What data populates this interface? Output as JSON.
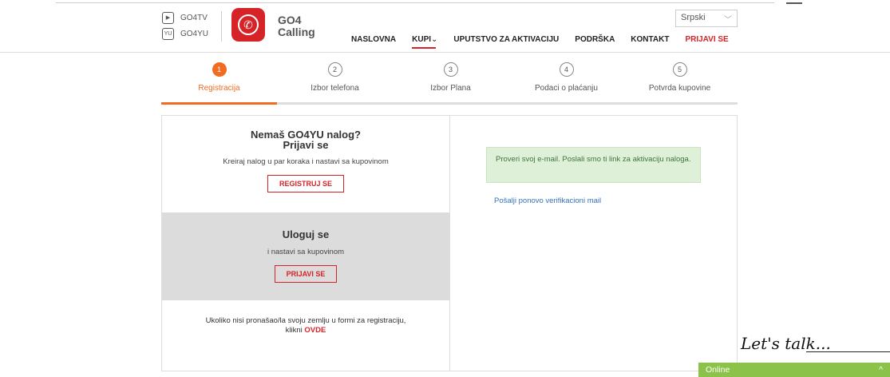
{
  "brands": [
    {
      "icon": "play-icon",
      "label": "GO4TV"
    },
    {
      "icon": "yu-icon",
      "label": "GO4YU"
    }
  ],
  "logo": {
    "line1": "GO4",
    "line2": "Calling"
  },
  "nav": {
    "items": [
      "NASLOVNA",
      "KUPI",
      "UPUTSTVO ZA AKTIVACIJU",
      "PODRŠKA",
      "KONTAKT"
    ],
    "kupi_caret": "⌄",
    "login": "PRIJAVI SE"
  },
  "language": {
    "selected": "Srpski"
  },
  "steps": [
    {
      "num": "1",
      "label": "Registracija"
    },
    {
      "num": "2",
      "label": "Izbor telefona"
    },
    {
      "num": "3",
      "label": "Izbor Plana"
    },
    {
      "num": "4",
      "label": "Podaci o plaćanju"
    },
    {
      "num": "5",
      "label": "Potvrda kupovine"
    }
  ],
  "register": {
    "title1": "Nemaš GO4YU nalog?",
    "title2": "Prijavi se",
    "desc": "Kreiraj nalog u par koraka i nastavi sa kupovinom",
    "button": "REGISTRUJ SE"
  },
  "login_section": {
    "title": "Uloguj se",
    "desc": "i nastavi sa kupovinom",
    "button": "PRIJAVI SE"
  },
  "country_note": {
    "text1": "Ukoliko nisi pronašao/la svoju zemlju u formi za registraciju,",
    "text2": "klikni",
    "link": "OVDE"
  },
  "alert": {
    "text": "Proveri svoj e-mail. Poslali smo ti link za aktivaciju naloga."
  },
  "resend_link": "Pošalji ponovo verifikacioni mail",
  "chat": {
    "tagline": "Let's talk...",
    "status": "Online",
    "toggle": "^"
  },
  "colors": {
    "accent": "#d62328",
    "step_active": "#f26b22",
    "alert_bg": "#dff0d8",
    "chat": "#8bc34a"
  }
}
